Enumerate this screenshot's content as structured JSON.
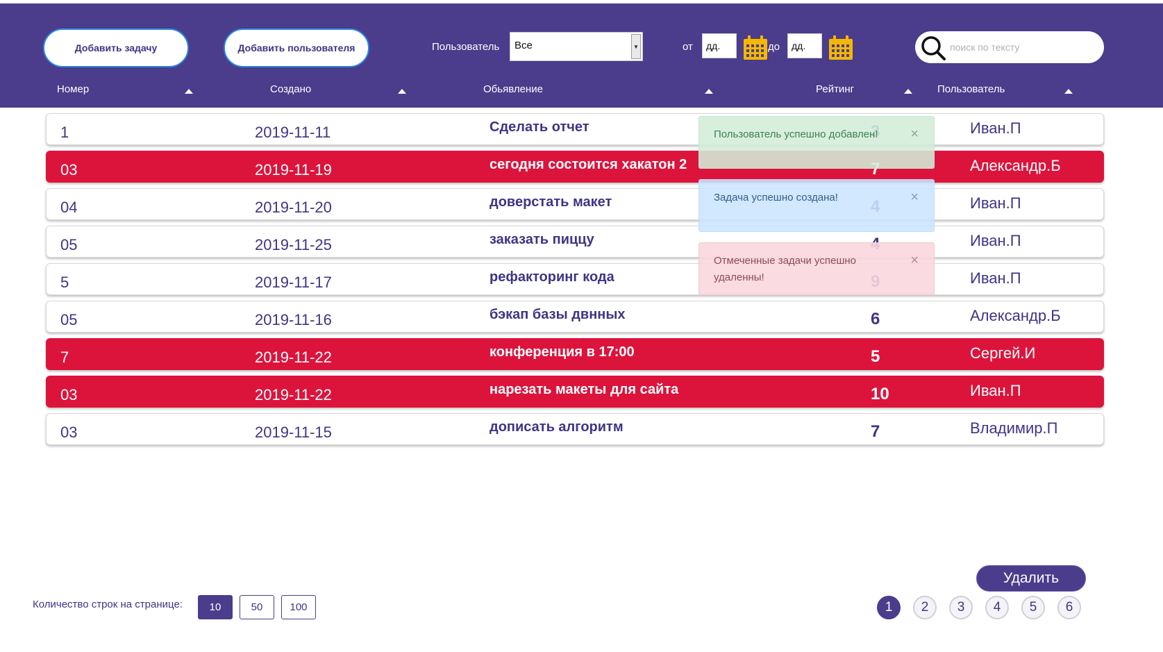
{
  "toolbar": {
    "add_task_label": "Добавить задачу",
    "add_user_label": "Добавить пользователя",
    "user_filter_label": "Пользователь",
    "user_filter_value": "Все",
    "from_label": "от",
    "from_value": "дд.",
    "to_label": "до",
    "to_value": "дд.",
    "search_placeholder": "поиск по тексту"
  },
  "columns": [
    "Номер",
    "Создано",
    "Обьявление",
    "Рейтинг",
    "Пользователь"
  ],
  "rows": [
    {
      "num": "1",
      "date": "2019-11-11",
      "title": "Сделать отчет",
      "rating": "3",
      "user": "Иван.П",
      "highlighted": false
    },
    {
      "num": "03",
      "date": "2019-11-19",
      "title": "сегодня состоится хакатон 2",
      "rating": "7",
      "user": "Александр.Б",
      "highlighted": true
    },
    {
      "num": "04",
      "date": "2019-11-20",
      "title": "доверстать макет",
      "rating": "4",
      "user": "Иван.П",
      "highlighted": false
    },
    {
      "num": "05",
      "date": "2019-11-25",
      "title": "заказать пиццу",
      "rating": "4",
      "user": "Иван.П",
      "highlighted": false
    },
    {
      "num": "5",
      "date": "2019-11-17",
      "title": "рефакторинг кода",
      "rating": "9",
      "user": "Иван.П",
      "highlighted": false
    },
    {
      "num": "05",
      "date": "2019-11-16",
      "title": "бэкап базы двнных",
      "rating": "6",
      "user": "Александр.Б",
      "highlighted": false
    },
    {
      "num": "7",
      "date": "2019-11-22",
      "title": "конференция в 17:00",
      "rating": "5",
      "user": "Сергей.И",
      "highlighted": true
    },
    {
      "num": "03",
      "date": "2019-11-22",
      "title": "нарезать макеты для сайта",
      "rating": "10",
      "user": "Иван.П",
      "highlighted": true
    },
    {
      "num": "03",
      "date": "2019-11-15",
      "title": "дописать алгоритм",
      "rating": "7",
      "user": "Владимир.П",
      "highlighted": false
    }
  ],
  "toasts": [
    {
      "type": "success",
      "text": "Пользователь успешно добавлен!"
    },
    {
      "type": "info",
      "text": "Задача успешно создана!"
    },
    {
      "type": "danger",
      "text": "Отмеченные задачи успешно удаленны!"
    }
  ],
  "toast_close_glyph": "×",
  "footer": {
    "rows_per_page_label": "Количество строк на странице:",
    "page_sizes": [
      "10",
      "50",
      "100"
    ],
    "active_page_size": "10",
    "delete_label": "Удалить",
    "pages": [
      "1",
      "2",
      "3",
      "4",
      "5",
      "6"
    ],
    "active_page": "1"
  },
  "colors": {
    "header_bg": "#4b3c8c",
    "highlight_row": "#dc143c",
    "text_primary": "#3e3585",
    "calendar_icon": "#f5b800"
  },
  "icons": {
    "search": "search-icon",
    "calendar": "calendar-icon",
    "sort": "sort-arrow-icon",
    "dropdown": "dropdown-arrow-icon"
  }
}
